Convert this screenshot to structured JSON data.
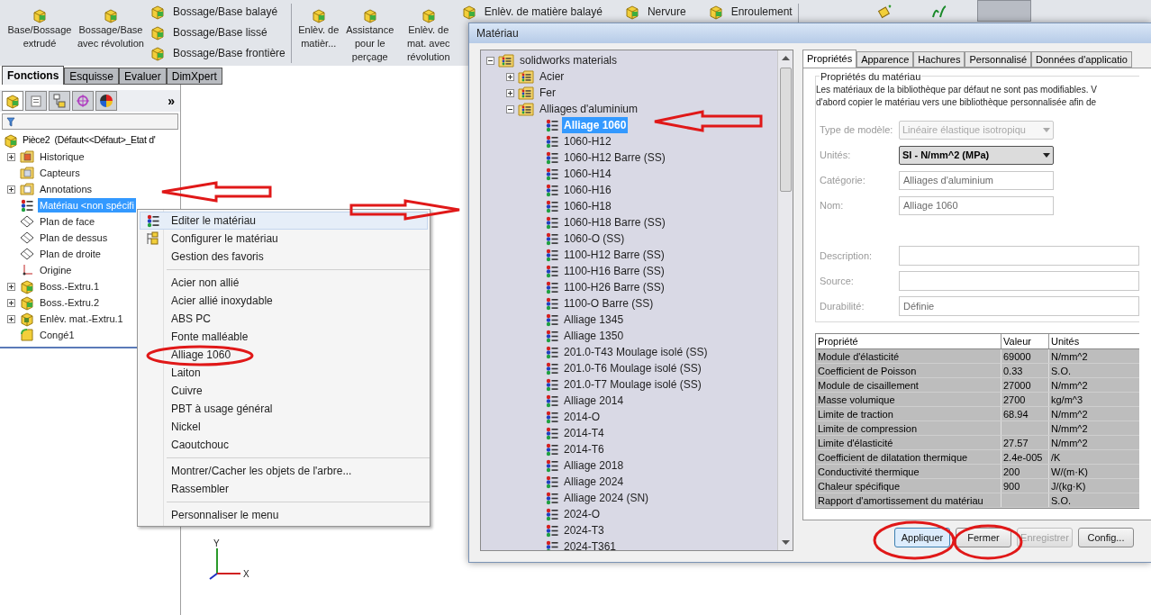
{
  "toolbar": {
    "groups": [
      {
        "kind": "large",
        "label": "Base/Bossage extrudé"
      },
      {
        "kind": "large",
        "label": "Bossage/Base avec révolution"
      },
      {
        "kind": "stack",
        "items": [
          "Bossage/Base balayé",
          "Bossage/Base lissé",
          "Bossage/Base frontière"
        ]
      },
      {
        "kind": "separator"
      },
      {
        "kind": "large",
        "label": "Enlèv. de matièr..."
      },
      {
        "kind": "large",
        "label": "Assistance pour le perçage"
      },
      {
        "kind": "large",
        "label": "Enlèv. de mat. avec révolution"
      },
      {
        "kind": "stack",
        "items": [
          "Enlèv. de matière balayé"
        ]
      },
      {
        "kind": "small",
        "label": "Nervure"
      },
      {
        "kind": "small",
        "label": "Enroulement"
      },
      {
        "kind": "separator"
      }
    ]
  },
  "tabs": [
    {
      "label": "Fonctions",
      "selected": true
    },
    {
      "label": "Esquisse",
      "selected": false
    },
    {
      "label": "Evaluer",
      "selected": false
    },
    {
      "label": "DimXpert",
      "selected": false
    }
  ],
  "panel_more": "»",
  "tree": {
    "root": "Pièce2  (Défaut<<Défaut>_Etat d'",
    "items": [
      {
        "label": "Historique",
        "kind": "history",
        "has_children": true,
        "selected": false
      },
      {
        "label": "Capteurs",
        "kind": "sensor",
        "has_children": false,
        "selected": false
      },
      {
        "label": "Annotations",
        "kind": "annotation",
        "has_children": true,
        "selected": false
      },
      {
        "label": "Matériau <non spécifi",
        "kind": "material",
        "has_children": false,
        "selected": true
      },
      {
        "label": "Plan de face",
        "kind": "plane",
        "has_children": false,
        "selected": false
      },
      {
        "label": "Plan de dessus",
        "kind": "plane",
        "has_children": false,
        "selected": false
      },
      {
        "label": "Plan de droite",
        "kind": "plane",
        "has_children": false,
        "selected": false
      },
      {
        "label": "Origine",
        "kind": "origin",
        "has_children": false,
        "selected": false
      },
      {
        "label": "Boss.-Extru.1",
        "kind": "extrude",
        "has_children": true,
        "selected": false
      },
      {
        "label": "Boss.-Extru.2",
        "kind": "extrude",
        "has_children": true,
        "selected": false
      },
      {
        "label": "Enlèv. mat.-Extru.1",
        "kind": "cut",
        "has_children": true,
        "selected": false
      },
      {
        "label": "Congé1",
        "kind": "fillet",
        "has_children": false,
        "selected": false
      }
    ]
  },
  "axis_labels": [
    "Y",
    "X"
  ],
  "context_menu": {
    "items": [
      {
        "kind": "item",
        "label": "Editer le matériau",
        "highlighted": true
      },
      {
        "kind": "item",
        "label": "Configurer le matériau",
        "highlighted": false
      },
      {
        "kind": "item",
        "label": "Gestion des favoris",
        "highlighted": false
      },
      {
        "kind": "separator"
      },
      {
        "kind": "item",
        "label": "Acier non allié",
        "highlighted": false
      },
      {
        "kind": "item",
        "label": "Acier allié inoxydable",
        "highlighted": false
      },
      {
        "kind": "item",
        "label": "ABS PC",
        "highlighted": false
      },
      {
        "kind": "item",
        "label": "Fonte malléable",
        "highlighted": false
      },
      {
        "kind": "item",
        "label": "Alliage 1060",
        "highlighted": false
      },
      {
        "kind": "item",
        "label": "Laiton",
        "highlighted": false
      },
      {
        "kind": "item",
        "label": "Cuivre",
        "highlighted": false
      },
      {
        "kind": "item",
        "label": "PBT à usage général",
        "highlighted": false
      },
      {
        "kind": "item",
        "label": "Nickel",
        "highlighted": false
      },
      {
        "kind": "item",
        "label": "Caoutchouc",
        "highlighted": false
      },
      {
        "kind": "separator"
      },
      {
        "kind": "item",
        "label": "Montrer/Cacher les objets de l'arbre...",
        "highlighted": false
      },
      {
        "kind": "item",
        "label": "Rassembler",
        "highlighted": false
      },
      {
        "kind": "separator"
      },
      {
        "kind": "item",
        "label": "Personnaliser le menu",
        "highlighted": false
      }
    ]
  },
  "dialog": {
    "title": "Matériau",
    "library": {
      "label": "solidworks materials",
      "expanded": true,
      "children": [
        {
          "label": "Acier",
          "expanded": false
        },
        {
          "label": "Fer",
          "expanded": false
        },
        {
          "label": "Alliages d'aluminium",
          "expanded": true,
          "children": [
            {
              "label": "Alliage 1060",
              "selected": true
            },
            {
              "label": "1060-H12",
              "selected": false
            },
            {
              "label": "1060-H12 Barre (SS)",
              "selected": false
            },
            {
              "label": "1060-H14",
              "selected": false
            },
            {
              "label": "1060-H16",
              "selected": false
            },
            {
              "label": "1060-H18",
              "selected": false
            },
            {
              "label": "1060-H18 Barre (SS)",
              "selected": false
            },
            {
              "label": "1060-O (SS)",
              "selected": false
            },
            {
              "label": "1100-H12 Barre (SS)",
              "selected": false
            },
            {
              "label": "1100-H16 Barre (SS)",
              "selected": false
            },
            {
              "label": "1100-H26 Barre (SS)",
              "selected": false
            },
            {
              "label": "1100-O Barre (SS)",
              "selected": false
            },
            {
              "label": "Alliage 1345",
              "selected": false
            },
            {
              "label": "Alliage 1350",
              "selected": false
            },
            {
              "label": "201.0-T43 Moulage isolé (SS)",
              "selected": false
            },
            {
              "label": "201.0-T6 Moulage isolé (SS)",
              "selected": false
            },
            {
              "label": "201.0-T7 Moulage isolé (SS)",
              "selected": false
            },
            {
              "label": "Alliage 2014",
              "selected": false
            },
            {
              "label": "2014-O",
              "selected": false
            },
            {
              "label": "2014-T4",
              "selected": false
            },
            {
              "label": "2014-T6",
              "selected": false
            },
            {
              "label": "Alliage 2018",
              "selected": false
            },
            {
              "label": "Alliage 2024",
              "selected": false
            },
            {
              "label": "Alliage 2024 (SN)",
              "selected": false
            },
            {
              "label": "2024-O",
              "selected": false
            },
            {
              "label": "2024-T3",
              "selected": false
            },
            {
              "label": "2024-T361",
              "selected": false
            }
          ]
        }
      ]
    },
    "tabs": [
      {
        "label": "Propriétés",
        "selected": true
      },
      {
        "label": "Apparence",
        "selected": false
      },
      {
        "label": "Hachures",
        "selected": false
      },
      {
        "label": "Personnalisé",
        "selected": false
      },
      {
        "label": "Données d'applicatio",
        "selected": false
      }
    ],
    "group_title": "Propriétés du matériau",
    "notice": [
      "Les matériaux de la bibliothèque par défaut ne sont pas modifiables. V",
      "d'abord copier le matériau vers une bibliothèque personnalisée afin de"
    ],
    "fields": [
      {
        "label": "Type de modèle:",
        "kind": "select",
        "value": "Linéaire élastique isotropiqu",
        "disabled": true
      },
      {
        "label": "Unités:",
        "kind": "select",
        "value": "SI - N/mm^2 (MPa)",
        "disabled": false
      },
      {
        "label": "Catégorie:",
        "kind": "text",
        "value": "Alliages d'aluminium"
      },
      {
        "label": "Nom:",
        "kind": "text",
        "value": "Alliage 1060"
      }
    ],
    "detail_fields": [
      {
        "label": "Description:"
      },
      {
        "label": "Source:"
      },
      {
        "label": "Durabilité:",
        "value": "Définie"
      }
    ],
    "table": {
      "columns": [
        "Propriété",
        "Valeur",
        "Unités"
      ],
      "rows": [
        [
          "Module d'élasticité",
          "69000",
          "N/mm^2"
        ],
        [
          "Coefficient de Poisson",
          "0.33",
          "S.O."
        ],
        [
          "Module de cisaillement",
          "27000",
          "N/mm^2"
        ],
        [
          "Masse volumique",
          "2700",
          "kg/m^3"
        ],
        [
          "Limite de traction",
          "68.94",
          "N/mm^2"
        ],
        [
          "Limite de compression",
          "",
          "N/mm^2"
        ],
        [
          "Limite d'élasticité",
          "27.57",
          "N/mm^2"
        ],
        [
          "Coefficient de dilatation thermique",
          "2.4e-005",
          "/K"
        ],
        [
          "Conductivité thermique",
          "200",
          "W/(m·K)"
        ],
        [
          "Chaleur spécifique",
          "900",
          "J/(kg·K)"
        ],
        [
          "Rapport d'amortissement du matériau",
          "",
          "S.O."
        ]
      ]
    },
    "buttons": [
      {
        "label": "Appliquer",
        "default": true,
        "disabled": false
      },
      {
        "label": "Fermer",
        "default": false,
        "disabled": false
      },
      {
        "label": "Enregistrer",
        "default": false,
        "disabled": true
      },
      {
        "label": "Config...",
        "default": false,
        "disabled": false
      }
    ]
  }
}
